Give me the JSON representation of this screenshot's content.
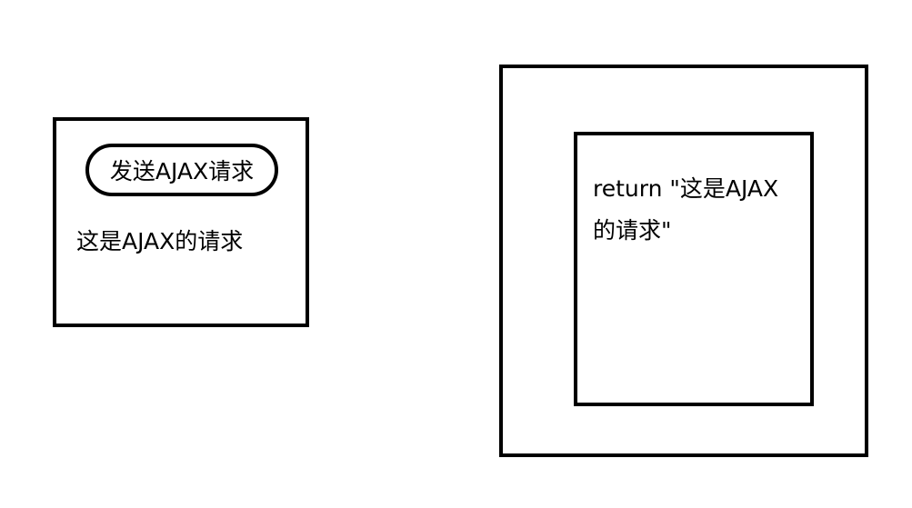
{
  "client": {
    "button_label": "发送AJAX请求",
    "response_text": "这是AJAX的请求"
  },
  "server": {
    "return_line_1": "return \"这是AJAX",
    "return_line_2": "的请求\""
  }
}
